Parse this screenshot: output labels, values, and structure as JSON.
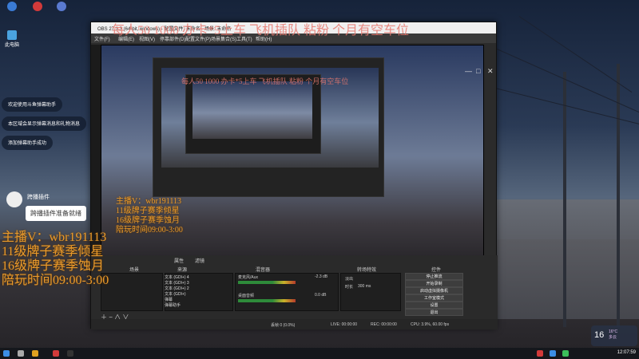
{
  "overlay": {
    "title": "每人50  1000 办卡*5上车     飞机插队  粘粉    个月有空车位",
    "title_nested": "每人50  1000 办卡*5上车     飞机插队  粘粉    个月有空车位",
    "lines": [
      "主播V：wbr191113",
      "11级牌子赛季倾星",
      "16级牌子赛季蚀月",
      "陪玩时间09:00-3:00"
    ],
    "lines_nested": [
      "主播V：wbr191113",
      "11级牌子赛季倾星",
      "16级牌子赛季蚀月",
      "陪玩时间09:00-3:00"
    ]
  },
  "chat": {
    "messages": [
      "欢迎使用斗鱼弹幕助手",
      "本区域会显示弹幕消息和礼物消息",
      "添加弹幕助手成功"
    ],
    "plugin_name": "跨播插件",
    "plugin_status": "跨播插件准备就绪"
  },
  "desktop": {
    "icons": [
      {
        "label": "",
        "color": "#3a7bd5",
        "icon": "search-icon"
      },
      {
        "label": "",
        "color": "#d23a3a",
        "icon": "app-icon"
      },
      {
        "label": "",
        "color": "#5a7ad0",
        "icon": "app-icon"
      },
      {
        "label": "此电脑",
        "color": "#4aa3df",
        "icon": "computer-icon"
      }
    ]
  },
  "obs": {
    "window_title": "OBS 27.1.3 (64-bit, windows) - 配置文件: 未命名 - 场景: 未命名",
    "menu": [
      "文件(F)",
      "编辑(E)",
      "视图(V)",
      "停靠部件(D)",
      "配置文件(P)",
      "场景集合(S)",
      "工具(T)",
      "帮助(H)"
    ],
    "dock_titles": {
      "scenes": "场景",
      "sources": "来源",
      "mixer": "混音器",
      "transitions": "转场特效",
      "controls": "控件"
    },
    "properties_label": "属性",
    "filters_label": "滤镜",
    "sources": [
      "文本 (GDI+) 4",
      "文本 (GDI+) 3",
      "文本 (GDI+) 2",
      "文本 (GDI+)",
      "弹幕",
      "弹幕助手"
    ],
    "mixer": {
      "channels": [
        {
          "name": "麦克风/Aux",
          "db": "-2.3 dB"
        },
        {
          "name": "桌面音频",
          "db": "0.0 dB"
        }
      ]
    },
    "transitions": {
      "type": "淡出",
      "duration_label": "时长",
      "duration_value": "300 ms"
    },
    "controls": [
      "停止推流",
      "开始录制",
      "启动虚拟摄像机",
      "工作室模式",
      "设置",
      "退出"
    ],
    "status": {
      "live": "LIVE: 00:00:00",
      "rec": "REC: 00:00:00",
      "cpu": "CPU: 3.9%, 60.00 fps",
      "dropped": "丢帧 0 (0.0%)"
    }
  },
  "taskbar": {
    "time": "12:07:59",
    "weather_temp": "16",
    "weather_line1": "16°C",
    "weather_line2": "多云"
  }
}
